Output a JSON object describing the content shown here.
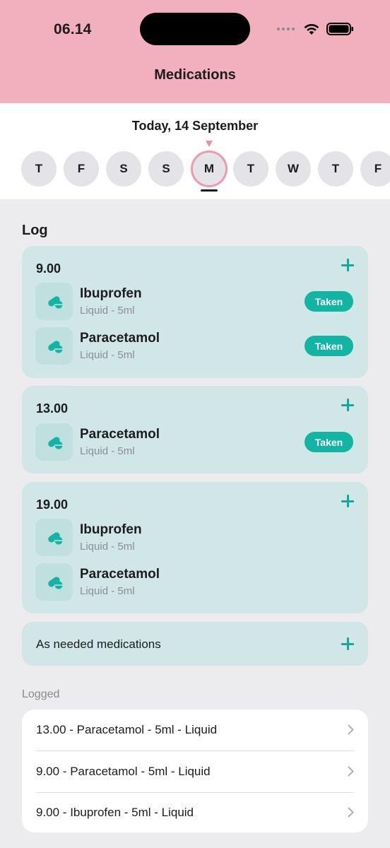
{
  "status_bar": {
    "time": "06.14",
    "icons": [
      "signal-dots-icon",
      "wifi-icon",
      "battery-icon"
    ]
  },
  "nav": {
    "title": "Medications"
  },
  "date_selector": {
    "label": "Today, 14 September",
    "days": [
      "T",
      "F",
      "S",
      "S",
      "M",
      "T",
      "W",
      "T",
      "F"
    ],
    "selected_index": 4
  },
  "log": {
    "title": "Log",
    "groups": [
      {
        "time": "9.00",
        "meds": [
          {
            "name": "Ibuprofen",
            "detail": "Liquid - 5ml",
            "status": "Taken"
          },
          {
            "name": "Paracetamol",
            "detail": "Liquid - 5ml",
            "status": "Taken"
          }
        ]
      },
      {
        "time": "13.00",
        "meds": [
          {
            "name": "Paracetamol",
            "detail": "Liquid - 5ml",
            "status": "Taken"
          }
        ]
      },
      {
        "time": "19.00",
        "meds": [
          {
            "name": "Ibuprofen",
            "detail": "Liquid - 5ml"
          },
          {
            "name": "Paracetamol",
            "detail": "Liquid - 5ml"
          }
        ]
      }
    ],
    "as_needed_label": "As needed medications"
  },
  "logged": {
    "title": "Logged",
    "entries": [
      "13.00 - Paracetamol - 5ml - Liquid",
      "9.00 - Paracetamol - 5ml - Liquid",
      "9.00 - Ibuprofen - 5ml - Liquid"
    ]
  },
  "colors": {
    "header": "#f2b0bd",
    "accent": "#12b4a3",
    "card": "#d0e6e7",
    "selected_ring": "#ee9aac"
  }
}
